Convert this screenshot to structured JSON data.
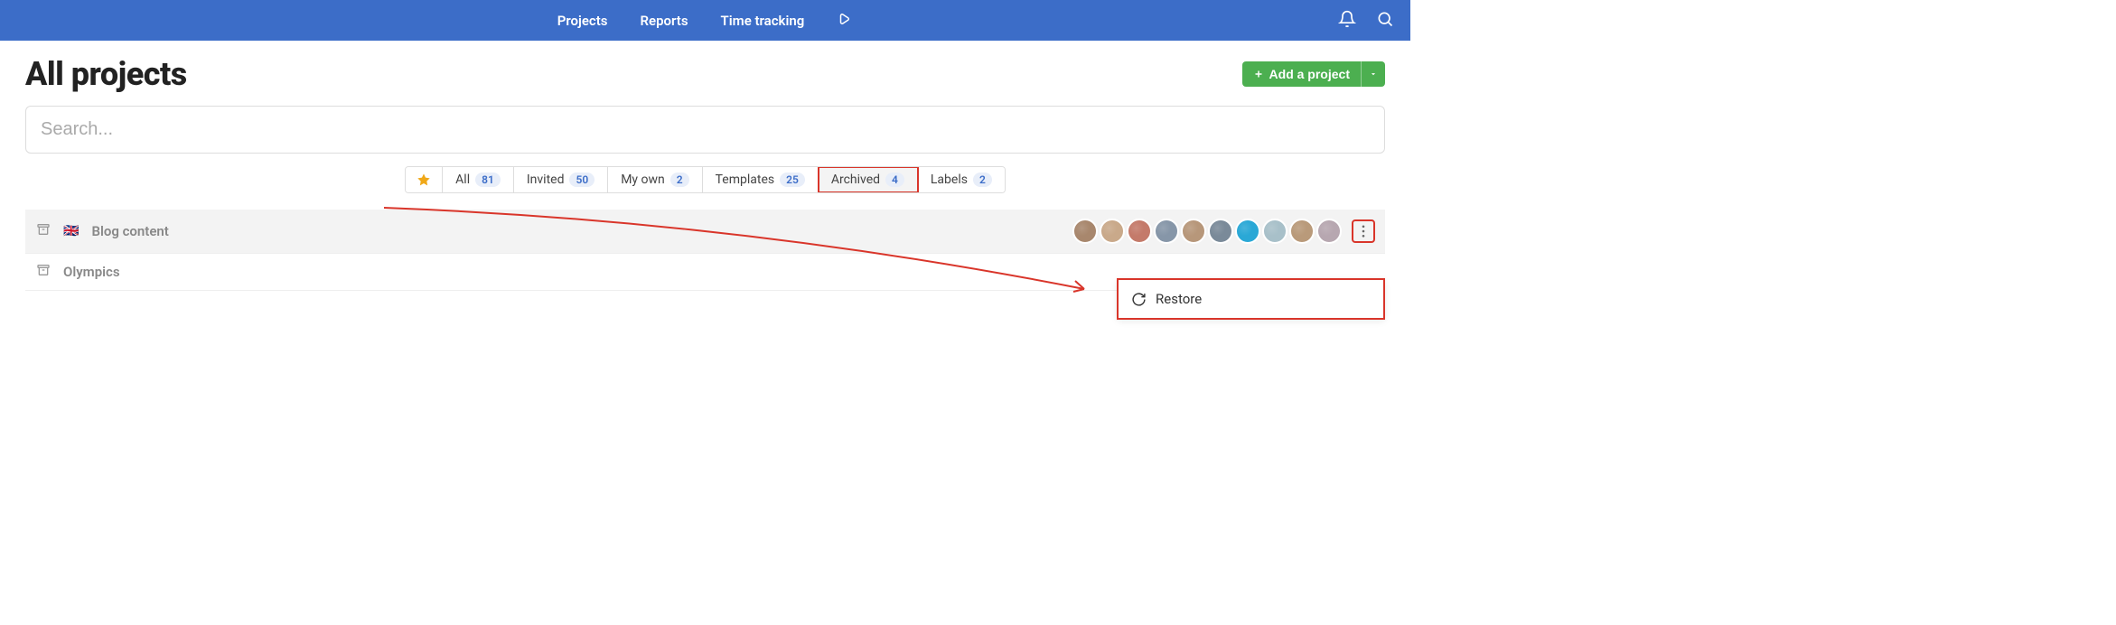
{
  "nav": {
    "items": [
      "Projects",
      "Reports",
      "Time tracking"
    ]
  },
  "page": {
    "title": "All projects"
  },
  "add_button": {
    "label": "Add a project"
  },
  "search": {
    "placeholder": "Search..."
  },
  "filters": [
    {
      "label": "All",
      "count": "81"
    },
    {
      "label": "Invited",
      "count": "50"
    },
    {
      "label": "My own",
      "count": "2"
    },
    {
      "label": "Templates",
      "count": "25"
    },
    {
      "label": "Archived",
      "count": "4",
      "active": true
    },
    {
      "label": "Labels",
      "count": "2"
    }
  ],
  "projects": [
    {
      "flag": "🇬🇧",
      "name": "Blog content",
      "hover": true,
      "avatar_count": 10
    },
    {
      "flag": "",
      "name": "Olympics",
      "hover": false,
      "avatar_count": 0
    }
  ],
  "dropdown": {
    "restore": "Restore"
  },
  "avatar_colors": [
    "#a8876d",
    "#c9a98a",
    "#c47a6a",
    "#8696a8",
    "#b7977a",
    "#7a8a99",
    "#2aa8d6",
    "#a8c0c9",
    "#b99a7a",
    "#b7a7b0"
  ]
}
